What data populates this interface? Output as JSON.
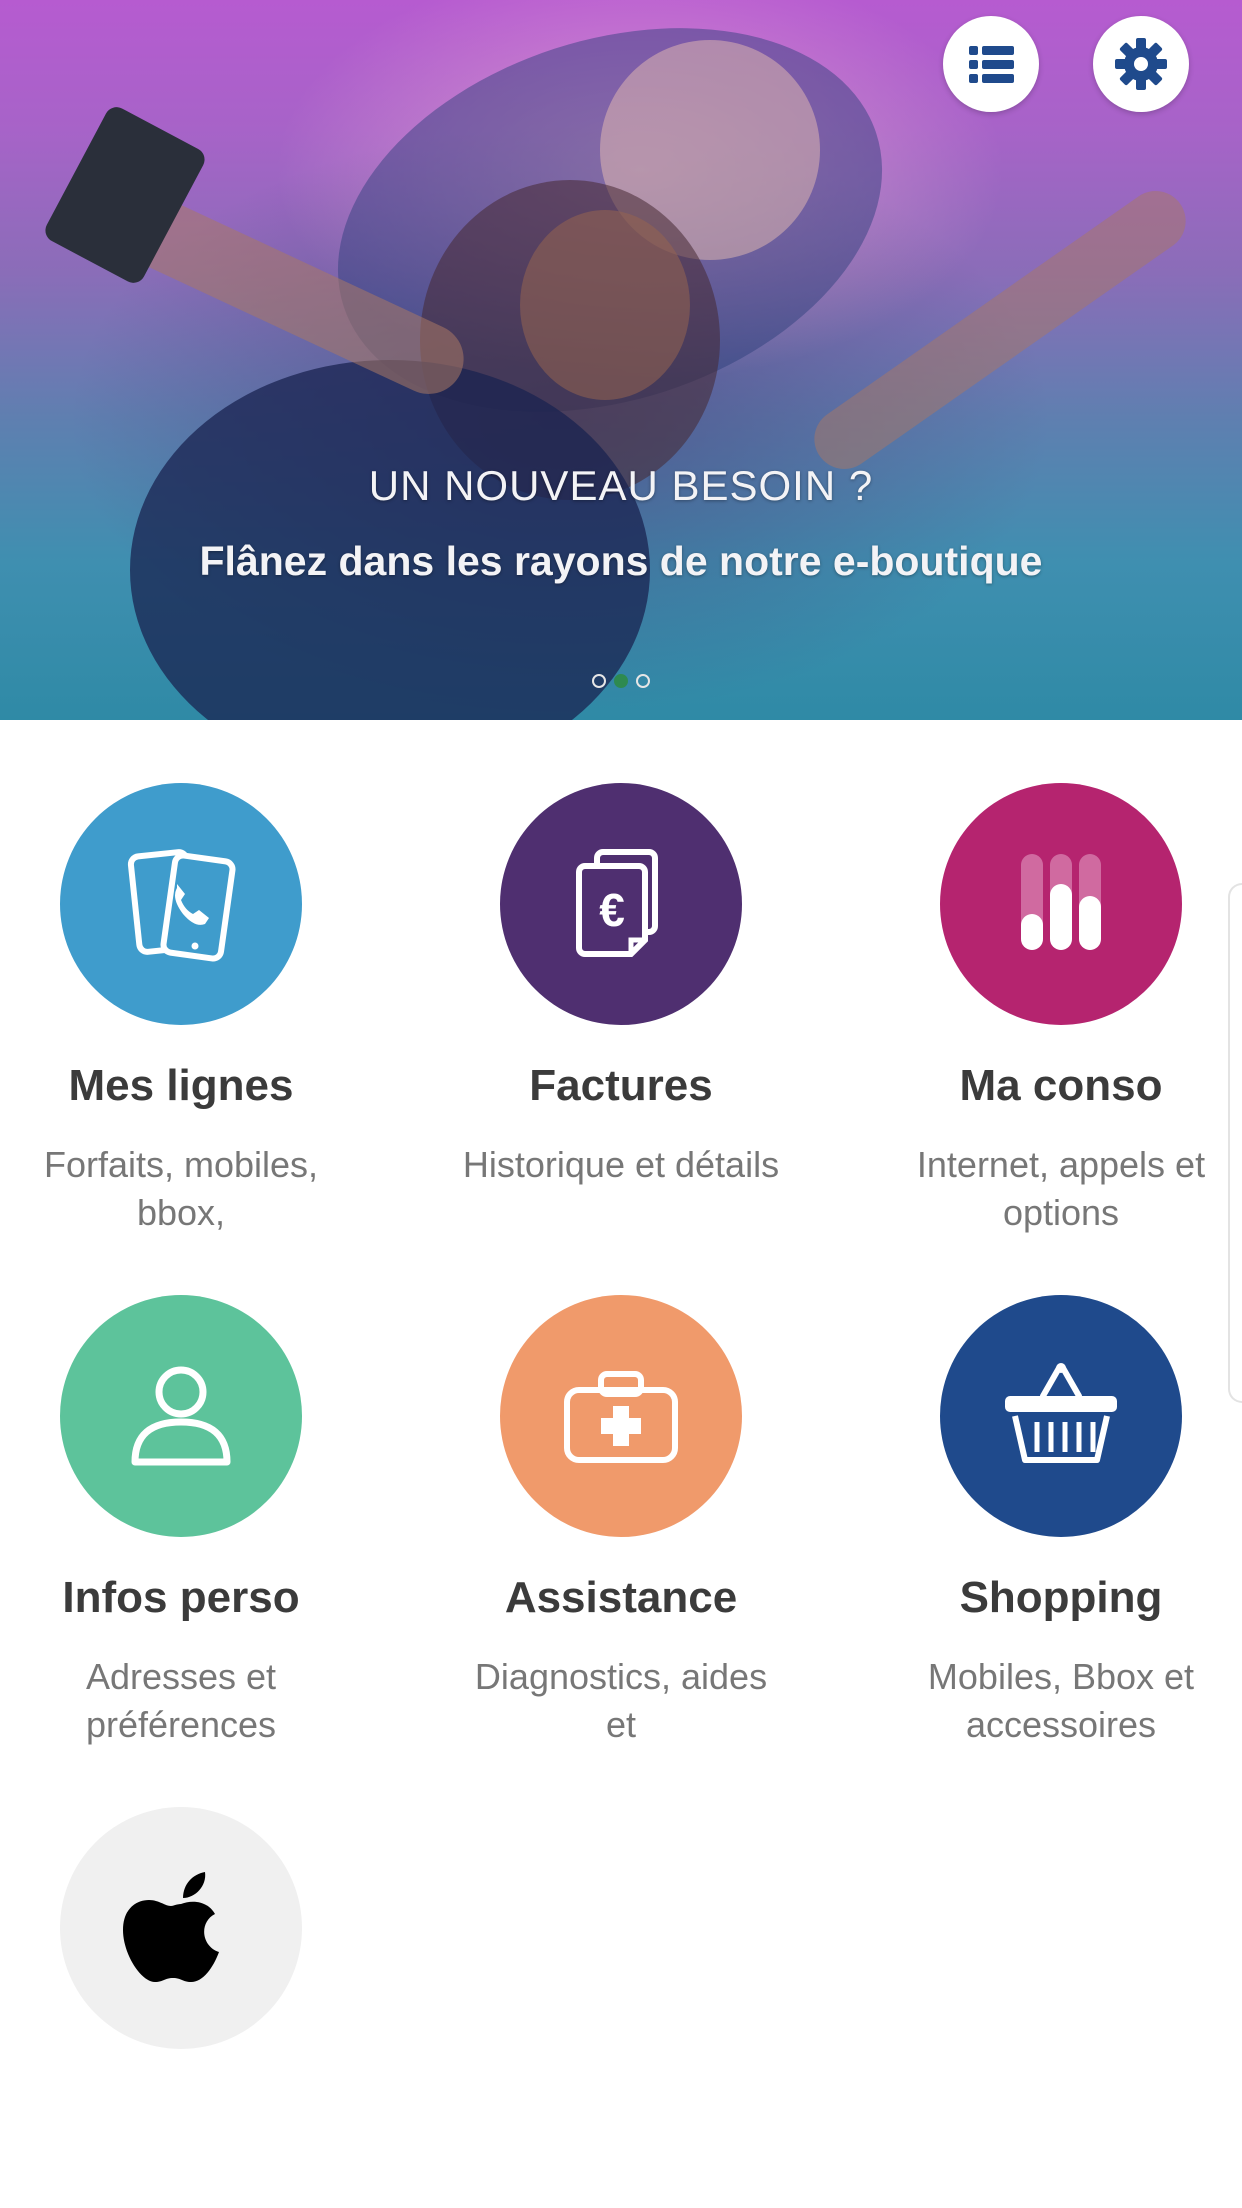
{
  "hero": {
    "line1": "UN NOUVEAU BESOIN ?",
    "line2": "Flânez dans les rayons de notre e-boutique",
    "carousel": {
      "count": 3,
      "active_index": 1
    }
  },
  "header": {
    "list_icon": "list-icon",
    "settings_icon": "gear-icon"
  },
  "tiles": [
    {
      "title": "Mes lignes",
      "subtitle": "Forfaits, mobiles, bbox,",
      "icon": "phones-icon",
      "color": "#3f9ccc"
    },
    {
      "title": "Factures",
      "subtitle": "Historique et détails",
      "icon": "euro-invoice-icon",
      "color": "#4f2f70"
    },
    {
      "title": "Ma conso",
      "subtitle": "Internet, appels et options",
      "icon": "usage-bars-icon",
      "color": "#b5246f"
    },
    {
      "title": "Infos perso",
      "subtitle": "Adresses et préférences",
      "icon": "user-icon",
      "color": "#5dc39b"
    },
    {
      "title": "Assistance",
      "subtitle": "Diagnostics, aides et",
      "icon": "first-aid-kit-icon",
      "color": "#f09a6b"
    },
    {
      "title": "Shopping",
      "subtitle": "Mobiles, Bbox et accessoires",
      "icon": "basket-icon",
      "color": "#1f4a8c"
    },
    {
      "title": "",
      "subtitle": "",
      "icon": "apple-icon",
      "color": "#f0f0f0"
    }
  ]
}
